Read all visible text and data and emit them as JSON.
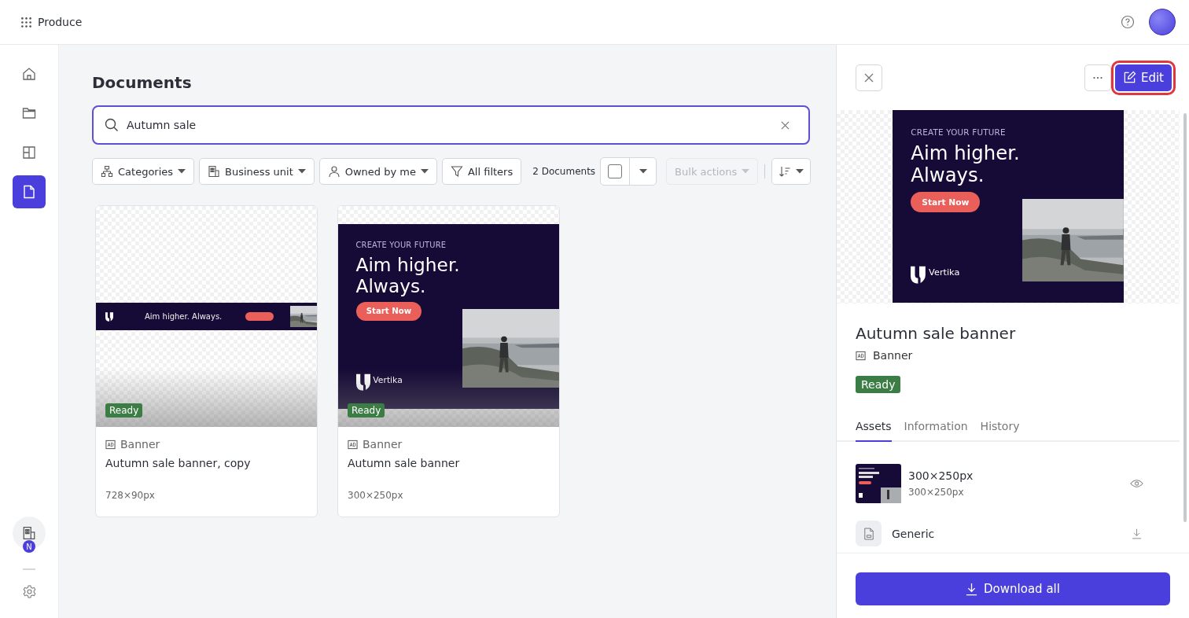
{
  "app": {
    "name": "Produce"
  },
  "nav": [
    {
      "kind": "home",
      "selected": false
    },
    {
      "kind": "folder",
      "selected": false
    },
    {
      "kind": "layout",
      "selected": false
    },
    {
      "kind": "document",
      "selected": true
    }
  ],
  "workspace": {
    "initial": "N"
  },
  "page": {
    "title": "Documents"
  },
  "search": {
    "value": "Autumn sale"
  },
  "filters": [
    {
      "kind": "categories",
      "label": "Categories"
    },
    {
      "kind": "business",
      "label": "Business unit"
    },
    {
      "kind": "owner",
      "label": "Owned by me"
    },
    {
      "kind": "all",
      "label": "All filters"
    }
  ],
  "result_count": "2 Documents",
  "select_all": {
    "checked": false
  },
  "bulk_actions": {
    "label": "Bulk actions",
    "disabled": true
  },
  "documents": [
    {
      "kind": "leaderboard",
      "status": "Ready",
      "type": "Banner",
      "name": "Autumn sale banner, copy",
      "size": "728×90px",
      "creative": {
        "headline": "Aim higher. Always."
      }
    },
    {
      "kind": "rectangle",
      "status": "Ready",
      "type": "Banner",
      "name": "Autumn sale banner",
      "size": "300×250px",
      "creative": {
        "eyebrow": "CREATE YOUR FUTURE",
        "headline_lines": [
          "Aim higher.",
          "Always."
        ],
        "cta": "Start Now",
        "brand": "Vertika"
      }
    }
  ],
  "panel": {
    "edit": {
      "label": "Edit",
      "highlighted": true
    },
    "creative": {
      "eyebrow": "CREATE YOUR FUTURE",
      "headline_lines": [
        "Aim higher.",
        "Always."
      ],
      "cta": "Start Now",
      "brand": "Vertika"
    },
    "title": "Autumn sale banner",
    "type": "Banner",
    "status": "Ready",
    "tabs": [
      {
        "label": "Assets",
        "selected": true
      },
      {
        "label": "Information",
        "selected": false
      },
      {
        "label": "History",
        "selected": false
      }
    ],
    "assets": [
      {
        "kind": "preview",
        "name": "300×250px",
        "size": "300×250px"
      },
      {
        "kind": "file",
        "name": "Generic"
      }
    ],
    "download": "Download all"
  }
}
